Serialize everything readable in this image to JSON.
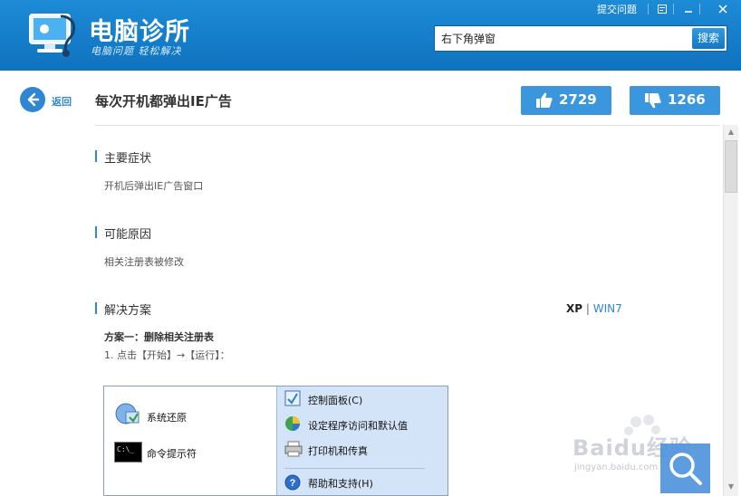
{
  "app": {
    "title": "电脑诊所",
    "slogan": "电脑问题 轻松解决",
    "submit_link": "提交问题",
    "controls": [
      "menu-icon",
      "minimize-icon",
      "close-icon"
    ]
  },
  "search": {
    "value": "右下角弹窗",
    "button": "搜索"
  },
  "nav": {
    "back_label": "返回"
  },
  "article": {
    "title": "每次开机都弹出IE广告",
    "likes": "2729",
    "dislikes": "1266"
  },
  "sections": {
    "symptom": {
      "title": "主要症状",
      "text": "开机后弹出IE广告窗口"
    },
    "cause": {
      "title": "可能原因",
      "text": "相关注册表被修改"
    },
    "solution": {
      "title": "解决方案",
      "os_options": [
        "XP",
        "WIN7"
      ],
      "os_separator": "|",
      "plan_title": "方案一：删除相关注册表",
      "step1": "1. 点击【开始】→【运行】："
    }
  },
  "screenshot_menu": {
    "left_items": [
      "系统还原",
      "命令提示符"
    ],
    "right_items": [
      "控制面板(C)",
      "设定程序访问和默认值",
      "打印机和传真",
      "帮助和支持(H)"
    ],
    "cmd_icon_text": "C:\\_"
  },
  "watermark": {
    "brand": "Baidu经验",
    "url": "jingyan.baidu.com"
  },
  "colors": {
    "header_blue": "#1382cc",
    "accent": "#2f86d4",
    "vote_button": "#3a97dd",
    "menu_panel": "#d3e4f8"
  }
}
